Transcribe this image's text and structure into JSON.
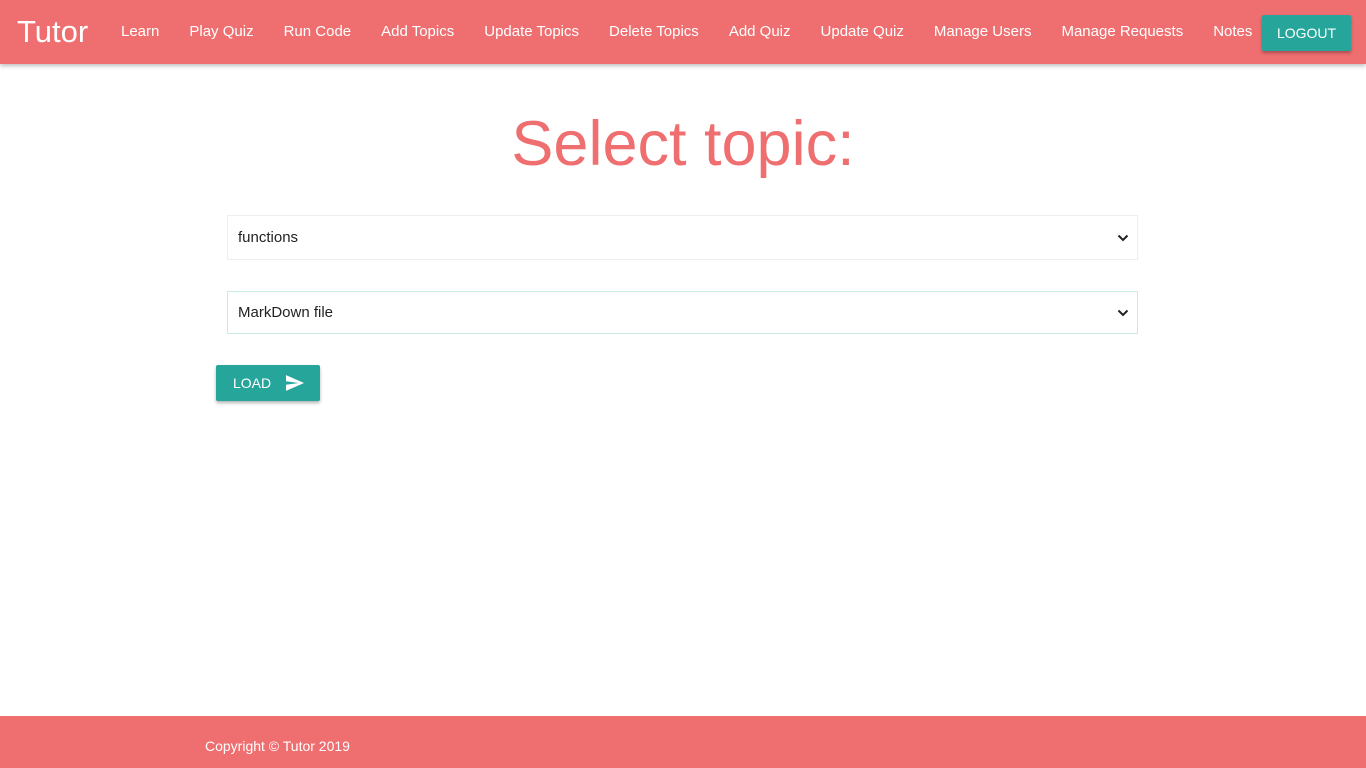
{
  "navbar": {
    "brand": "Tutor",
    "links": [
      {
        "label": "Learn"
      },
      {
        "label": "Play Quiz"
      },
      {
        "label": "Run Code"
      },
      {
        "label": "Add Topics"
      },
      {
        "label": "Update Topics"
      },
      {
        "label": "Delete Topics"
      },
      {
        "label": "Add Quiz"
      },
      {
        "label": "Update Quiz"
      },
      {
        "label": "Manage Users"
      },
      {
        "label": "Manage Requests"
      },
      {
        "label": "Notes"
      }
    ],
    "logout_label": "LOGOUT"
  },
  "main": {
    "title": "Select topic:",
    "topic_select": {
      "selected": "functions",
      "icon": "chevron-down-icon"
    },
    "format_select": {
      "selected": "MarkDown file",
      "icon": "chevron-down-icon"
    },
    "load_button": {
      "label": "LOAD",
      "icon": "send-icon"
    }
  },
  "footer": {
    "copyright": "Copyright © Tutor 2019"
  },
  "colors": {
    "primary": "#ef6e70",
    "accent": "#26a69a",
    "text_on_primary": "#ffffff"
  }
}
